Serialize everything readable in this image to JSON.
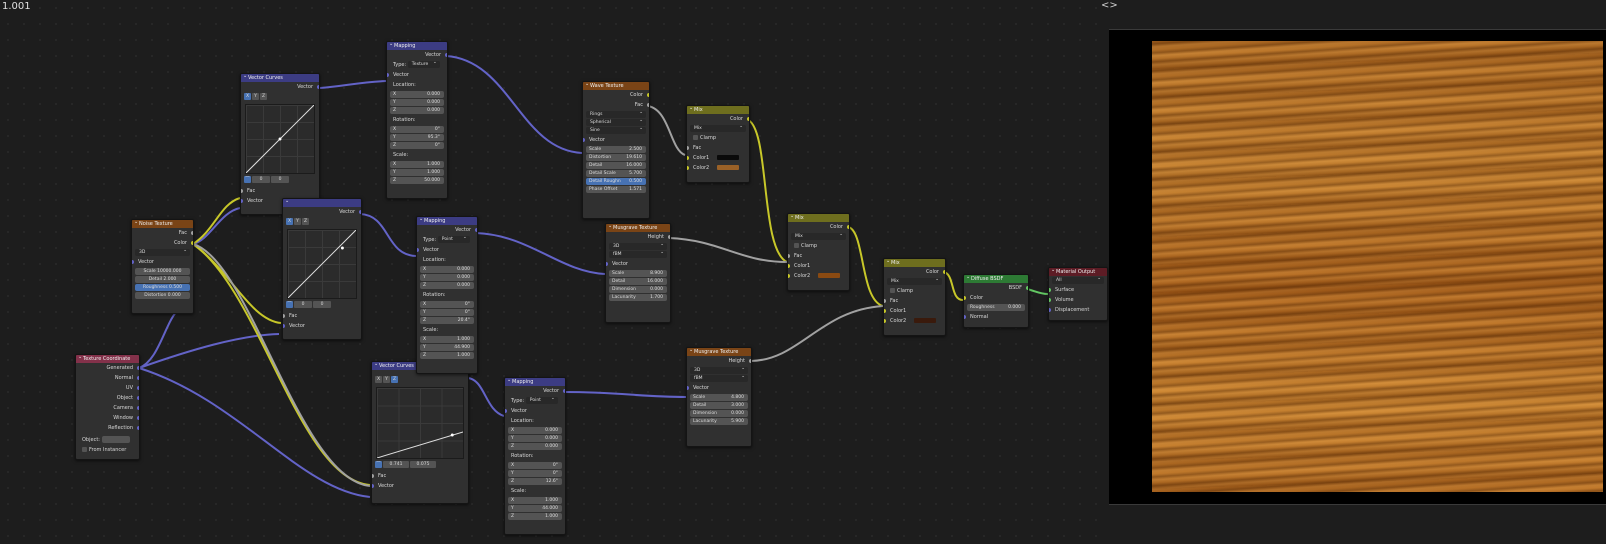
{
  "editor": {
    "title": "1.001"
  },
  "viewport": {
    "nav_arrows": "<>"
  },
  "colors": {
    "vector_socket": "#6363c7",
    "color_socket": "#c7c729",
    "float_socket": "#a1a1a1",
    "shader_socket": "#63c763",
    "texture_header": "#7a4416",
    "vector_header": "#3c3c83",
    "color_header": "#6e6e1e",
    "shader_header": "#2d7a34",
    "output_header": "#5d1c25",
    "input_header": "#83314a"
  },
  "nodes": {
    "texcoord": {
      "title": "Texture Coordinate",
      "outputs": [
        "Generated",
        "Normal",
        "UV",
        "Object",
        "Camera",
        "Window",
        "Reflection"
      ],
      "object_label": "Object:",
      "from_instancer": "From Instancer"
    },
    "noise": {
      "title": "Noise Texture",
      "out_fac": "Fac",
      "out_color": "Color",
      "dim": "3D",
      "in_vector": "Vector",
      "scale": "10000.000",
      "detail": "2.000",
      "roughness": "0.500",
      "distortion": "0.000",
      "scale_k": "Scale",
      "detail_k": "Detail",
      "roughness_k": "Roughness",
      "distortion_k": "Distortion"
    },
    "vcurves1": {
      "title": "Vector Curves",
      "out": "Vector",
      "x": "X",
      "y": "Y",
      "z": "Z",
      "val_a": "0",
      "val_b": "0",
      "in_fac": "Fac",
      "in_vec": "Vector"
    },
    "vcurves2": {
      "title": "",
      "out": "Vector",
      "x": "X",
      "y": "Y",
      "z": "Z",
      "val_a": "0",
      "val_b": "0",
      "in_fac": "Fac",
      "in_vec": "Vector"
    },
    "vcurves3": {
      "title": "Vector Curves",
      "x": "X",
      "y": "Y",
      "z": "Z",
      "val_a": "0.741",
      "val_b": "0.075",
      "in_fac": "Fac",
      "in_vec": "Vector"
    },
    "mapping1": {
      "title": "Mapping",
      "out": "Vector",
      "type_label": "Type:",
      "type": "Texture",
      "in_vec": "Vector",
      "location": "Location:",
      "loc": [
        "0.000",
        "0.000",
        "0.000"
      ],
      "rotation": "Rotation:",
      "rot": [
        "0°",
        "95.3°",
        "0°"
      ],
      "scale": "Scale:",
      "scl": [
        "1.000",
        "1.000",
        "50.000"
      ]
    },
    "mapping2": {
      "title": "Mapping",
      "out": "Vector",
      "type_label": "Type:",
      "type": "Point",
      "in_vec": "Vector",
      "location": "Location:",
      "loc": [
        "0.000",
        "0.000",
        "0.000"
      ],
      "rotation": "Rotation:",
      "rot": [
        "0°",
        "0°",
        "20.4°"
      ],
      "scale": "Scale:",
      "scl": [
        "1.000",
        "44.900",
        "1.000"
      ]
    },
    "mapping3": {
      "title": "Mapping",
      "out": "Vector",
      "type_label": "Type:",
      "type": "Point",
      "in_vec": "Vector",
      "location": "Location:",
      "loc": [
        "0.000",
        "0.000",
        "0.000"
      ],
      "rotation": "Rotation:",
      "rot": [
        "0°",
        "0°",
        "12.6°"
      ],
      "scale": "Scale:",
      "scl": [
        "1.000",
        "44.000",
        "1.000"
      ]
    },
    "wave": {
      "title": "Wave Texture",
      "out_color": "Color",
      "out_fac": "Fac",
      "wave_type": "Rings",
      "direction": "Spherical",
      "profile": "Sine",
      "in_vec": "Vector",
      "scale_k": "Scale",
      "scale": "2.500",
      "distortion_k": "Distortion",
      "distortion": "19.610",
      "detail_k": "Detail",
      "detail": "16.000",
      "detail_scale_k": "Detail Scale",
      "detail_scale": "5.700",
      "detail_rough_k": "Detail Roughn",
      "detail_rough": "0.500",
      "phase_k": "Phase Offset",
      "phase": "1.571"
    },
    "musgrave1": {
      "title": "Musgrave Texture",
      "out": "Height",
      "dim": "3D",
      "type": "fBM",
      "in_vec": "Vector",
      "scale_k": "Scale",
      "scale": "8.900",
      "detail_k": "Detail",
      "detail": "16.000",
      "dimension_k": "Dimension",
      "dimension": "0.000",
      "lac_k": "Lacunarity",
      "lac": "1.700"
    },
    "musgrave2": {
      "title": "Musgrave Texture",
      "out": "Height",
      "dim": "3D",
      "type": "fBM",
      "in_vec": "Vector",
      "scale_k": "Scale",
      "scale": "4.800",
      "detail_k": "Detail",
      "detail": "3.000",
      "dimension_k": "Dimension",
      "dimension": "0.000",
      "lac_k": "Lacunarity",
      "lac": "5.900"
    },
    "mix1": {
      "title": "Mix",
      "out": "Color",
      "blend": "Mix",
      "clamp": "Clamp",
      "fac": "Fac",
      "c1": "Color1",
      "c2": "Color2",
      "c1_color": "#0a0a0a",
      "c2_color": "#9a6127"
    },
    "mix2": {
      "title": "Mix",
      "out": "Color",
      "blend": "Mix",
      "clamp": "Clamp",
      "fac": "Fac",
      "c1": "Color1",
      "c2": "Color2",
      "c2_color": "#8a4a12"
    },
    "mix3": {
      "title": "Mix",
      "out": "Color",
      "blend": "Mix",
      "clamp": "Clamp",
      "fac": "Fac",
      "c1": "Color1",
      "c2": "Color2",
      "c2_color": "#3a1a0c"
    },
    "diffuse": {
      "title": "Diffuse BSDF",
      "out": "BSDF",
      "color": "Color",
      "roughness_k": "Roughness",
      "roughness": "0.000",
      "normal": "Normal"
    },
    "output": {
      "title": "Material Output",
      "target": "All",
      "surface": "Surface",
      "volume": "Volume",
      "displacement": "Displacement"
    }
  }
}
